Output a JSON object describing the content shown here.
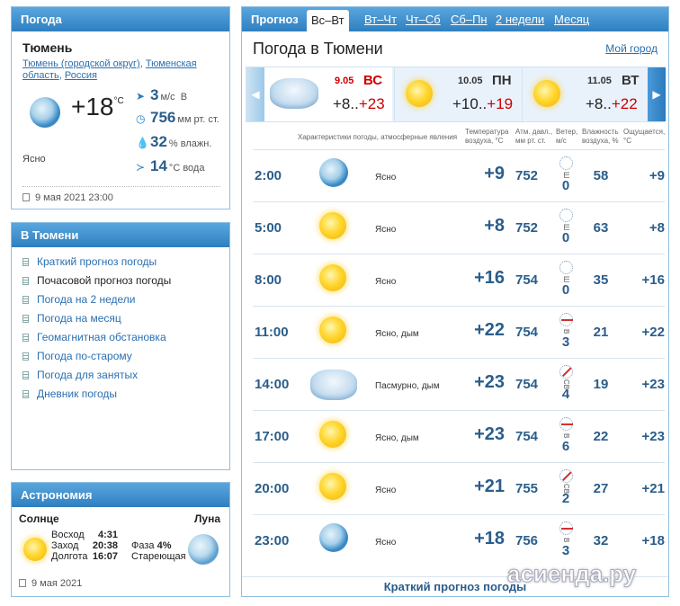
{
  "weather_panel": {
    "header": "Погода",
    "city": "Тюмень",
    "links_part1": "Тюмень (городской округ)",
    "links_part2": "Тюменская область",
    "links_part3": "Россия",
    "temp": "+18",
    "temp_unit": "°C",
    "wind_value": "3",
    "wind_unit": "м/с",
    "wind_dir": "В",
    "pressure_value": "756",
    "pressure_unit": "мм рт. ст.",
    "humidity_value": "32",
    "humidity_unit": "% влажн.",
    "water_value": "14",
    "water_unit": "°С вода",
    "sky": "Ясно",
    "date": "9 мая 2021 23:00"
  },
  "city_panel": {
    "header": "В Тюмени",
    "items": [
      "Краткий прогноз погоды",
      "Почасовой прогноз погоды",
      "Погода на 2 недели",
      "Погода на месяц",
      "Геомагнитная обстановка",
      "Погода по-старому",
      "Погода для занятых",
      "Дневник погоды"
    ]
  },
  "astro_panel": {
    "header": "Астрономия",
    "sun_label": "Солнце",
    "moon_label": "Луна",
    "rise_label": "Восход",
    "rise": "4:31",
    "set_label": "Заход",
    "set": "20:38",
    "length_label": "Долгота",
    "length": "16:07",
    "phase_label": "Фаза",
    "phase_value": "4%",
    "phase_name": "Стареющая",
    "date": "9 мая 2021"
  },
  "main": {
    "tab_lead": "Прогноз",
    "tabs": [
      "Вс–Вт",
      "Вт–Чт",
      "Чт–Сб",
      "Сб–Пн",
      "2 недели",
      "Месяц"
    ],
    "title": "Погода в Тюмени",
    "my_city": "Мой город",
    "days": [
      {
        "date": "9.05",
        "name": "ВС",
        "tmin": "+8..",
        "tmax": "+23"
      },
      {
        "date": "10.05",
        "name": "ПН",
        "tmin": "+10..",
        "tmax": "+19"
      },
      {
        "date": "11.05",
        "name": "ВТ",
        "tmin": "+8..",
        "tmax": "+22"
      }
    ],
    "col_headers": {
      "desc": "Характеристики погоды, атмосферные явления",
      "temp": "Температура воздуха, °С",
      "pres": "Атм. давл., мм рт. ст.",
      "wind": "Ветер, м/с",
      "hum": "Влажность воздуха, %",
      "feel": "Ощущается, °С"
    },
    "rows": [
      {
        "time": "2:00",
        "icon": "moon-icon",
        "desc": "Ясно",
        "temp": "+9",
        "pres": "752",
        "wind_dir": "Ш",
        "wind": "0",
        "hum": "58",
        "feel": "+9"
      },
      {
        "time": "5:00",
        "icon": "sun-icon",
        "desc": "Ясно",
        "temp": "+8",
        "pres": "752",
        "wind_dir": "Ш",
        "wind": "0",
        "hum": "63",
        "feel": "+8"
      },
      {
        "time": "8:00",
        "icon": "sun-icon",
        "desc": "Ясно",
        "temp": "+16",
        "pres": "754",
        "wind_dir": "Ш",
        "wind": "0",
        "hum": "35",
        "feel": "+16"
      },
      {
        "time": "11:00",
        "icon": "sun-icon",
        "desc": "Ясно, дым",
        "temp": "+22",
        "pres": "754",
        "wind_dir": "В",
        "wind": "3",
        "hum": "21",
        "feel": "+22"
      },
      {
        "time": "14:00",
        "icon": "cloud-icon",
        "desc": "Пасмурно, дым",
        "temp": "+23",
        "pres": "754",
        "wind_dir": "СВ",
        "wind": "4",
        "hum": "19",
        "feel": "+23"
      },
      {
        "time": "17:00",
        "icon": "sun-icon",
        "desc": "Ясно, дым",
        "temp": "+23",
        "pres": "754",
        "wind_dir": "В",
        "wind": "6",
        "hum": "22",
        "feel": "+23"
      },
      {
        "time": "20:00",
        "icon": "sun-icon",
        "desc": "Ясно",
        "temp": "+21",
        "pres": "755",
        "wind_dir": "СВ",
        "wind": "2",
        "hum": "27",
        "feel": "+21"
      },
      {
        "time": "23:00",
        "icon": "moon-icon",
        "desc": "Ясно",
        "temp": "+18",
        "pres": "756",
        "wind_dir": "В",
        "wind": "3",
        "hum": "32",
        "feel": "+18"
      }
    ],
    "footer": "Краткий прогноз погоды"
  },
  "watermark": "асиенда.ру"
}
